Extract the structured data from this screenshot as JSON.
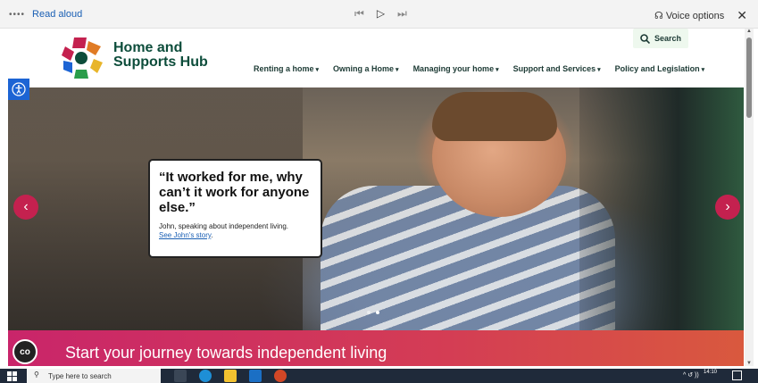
{
  "read_aloud": {
    "label": "Read aloud",
    "dots": "••••",
    "prev": "⏮",
    "play": "▷",
    "next": "⏭",
    "voice_options": "Voice options",
    "close": "✕"
  },
  "site": {
    "logo_line1": "Home and",
    "logo_line2": "Supports Hub",
    "search_label": "Search",
    "nav": [
      {
        "label": "Renting a home"
      },
      {
        "label": "Owning a Home"
      },
      {
        "label": "Managing your home"
      },
      {
        "label": "Support and Services"
      },
      {
        "label": "Policy and Legislation"
      }
    ],
    "caret": "▾"
  },
  "hero": {
    "quote": "“It worked for me, why can’t it work for anyone else.”",
    "sub": "John, speaking about independent living.",
    "link": "See John's story",
    "link_suffix": ".",
    "prev_arrow": "‹",
    "next_arrow": "›",
    "slides": 2,
    "active_slide": 2
  },
  "banner": {
    "text": "Start your journey towards independent living",
    "chat_icon": "co"
  },
  "taskbar": {
    "search_placeholder": "Type here to search",
    "time": "14:10",
    "tray": "^ ↺ ))",
    "search_icon": "⚲"
  },
  "colors": {
    "brand_green": "#0d4d3b",
    "accent_pink": "#c4214f",
    "link_blue": "#1a5fb4"
  }
}
